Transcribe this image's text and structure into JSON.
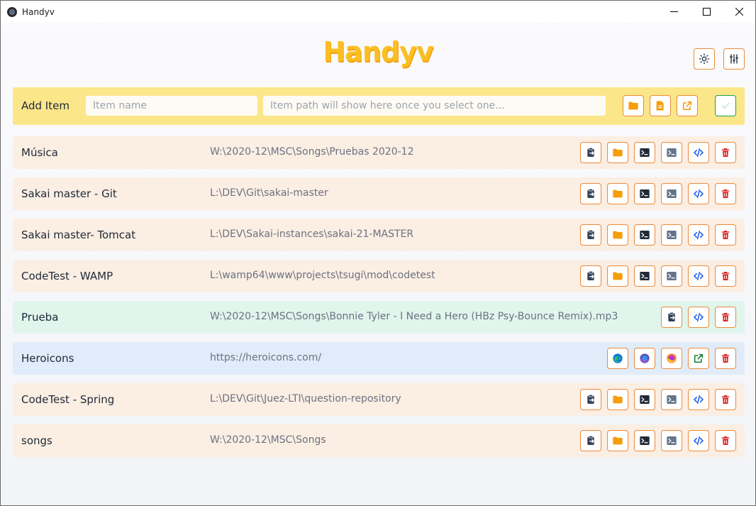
{
  "window": {
    "title": "Handyv"
  },
  "header": {
    "logo": "Handyv"
  },
  "add_bar": {
    "label": "Add Item",
    "name_placeholder": "Item name",
    "path_placeholder": "Item path will show here once you select one..."
  },
  "colors": {
    "accent": "#fbbf24",
    "button_border": "#ea8a3a",
    "folder_row": "#fbeee3",
    "file_row": "#e0f5ec",
    "web_row": "#e1ecfa",
    "delete": "#dc2626",
    "code": "#2563eb",
    "terminal": "#334155"
  },
  "items": [
    {
      "name": "Música",
      "path": "W:\\2020-12\\MSC\\Songs\\Pruebas 2020-12",
      "type": "folder"
    },
    {
      "name": "Sakai master - Git",
      "path": "L:\\DEV\\Git\\sakai-master",
      "type": "folder"
    },
    {
      "name": "Sakai master- Tomcat",
      "path": "L:\\DEV\\Sakai-instances\\sakai-21-MASTER",
      "type": "folder"
    },
    {
      "name": "CodeTest - WAMP",
      "path": "L:\\wamp64\\www\\projects\\tsugi\\mod\\codetest",
      "type": "folder"
    },
    {
      "name": "Prueba",
      "path": "W:\\2020-12\\MSC\\Songs\\Bonnie Tyler - I Need a Hero (HBz Psy-Bounce Remix).mp3",
      "type": "file"
    },
    {
      "name": "Heroicons",
      "path": "https://heroicons.com/",
      "type": "web"
    },
    {
      "name": "CodeTest - Spring",
      "path": "L:\\DEV\\Git\\Juez-LTI\\question-repository",
      "type": "folder"
    },
    {
      "name": "songs",
      "path": "W:\\2020-12\\MSC\\Songs",
      "type": "folder"
    }
  ],
  "icons": {
    "folder_actions": [
      "clipboard-icon",
      "folder-icon",
      "terminal-icon",
      "powershell-icon",
      "code-icon",
      "trash-icon"
    ],
    "file_actions": [
      "clipboard-icon",
      "code-icon",
      "trash-icon"
    ],
    "web_actions": [
      "edge-icon",
      "firefox-dev-icon",
      "firefox-icon",
      "external-link-icon",
      "trash-icon"
    ]
  }
}
